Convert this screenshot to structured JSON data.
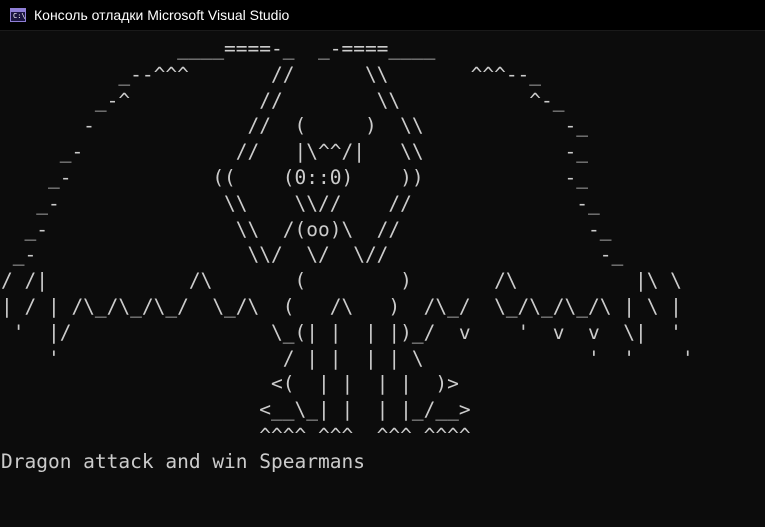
{
  "window": {
    "title": "Консоль отладки Microsoft Visual Studio",
    "icon": "console-app-icon",
    "icon_glyph": "C:\\"
  },
  "console": {
    "ascii_art": [
      "               ____====-_  _-====____",
      "          _--^^^       //      \\\\       ^^^--_",
      "        _-^           //        \\\\           ^-_",
      "       -             //  (     )  \\\\            -_",
      "     _-             //   |\\^^/|   \\\\            -_",
      "    _-            ((    (0::0)    ))            -_",
      "   _-              \\\\    \\\\//    //              -_",
      "  _-                \\\\  /(oo)\\  //                -_",
      " _-                  \\\\/  \\/  \\//                  -_",
      "/ /|            /\\       (        )       /\\          |\\ \\",
      "| / | /\\_/\\_/\\_/  \\_/\\  (   /\\   )  /\\_/  \\_/\\_/\\_/\\ | \\ |",
      " '  |/                 \\_(| |  | |)_/  v    '  v  v  \\|  '",
      "    '                   / | |  | | \\              '  '    '",
      "                       <(  | |  | |  )>",
      "                      <__\\_| |  | |_/__>",
      "                      ^^^^ ^^^  ^^^ ^^^^"
    ],
    "message": "Dragon attack and win Spearmans"
  },
  "colors": {
    "background": "#0c0c0c",
    "text": "#cccccc",
    "titlebar": "#000000",
    "title_text": "#ffffff"
  }
}
